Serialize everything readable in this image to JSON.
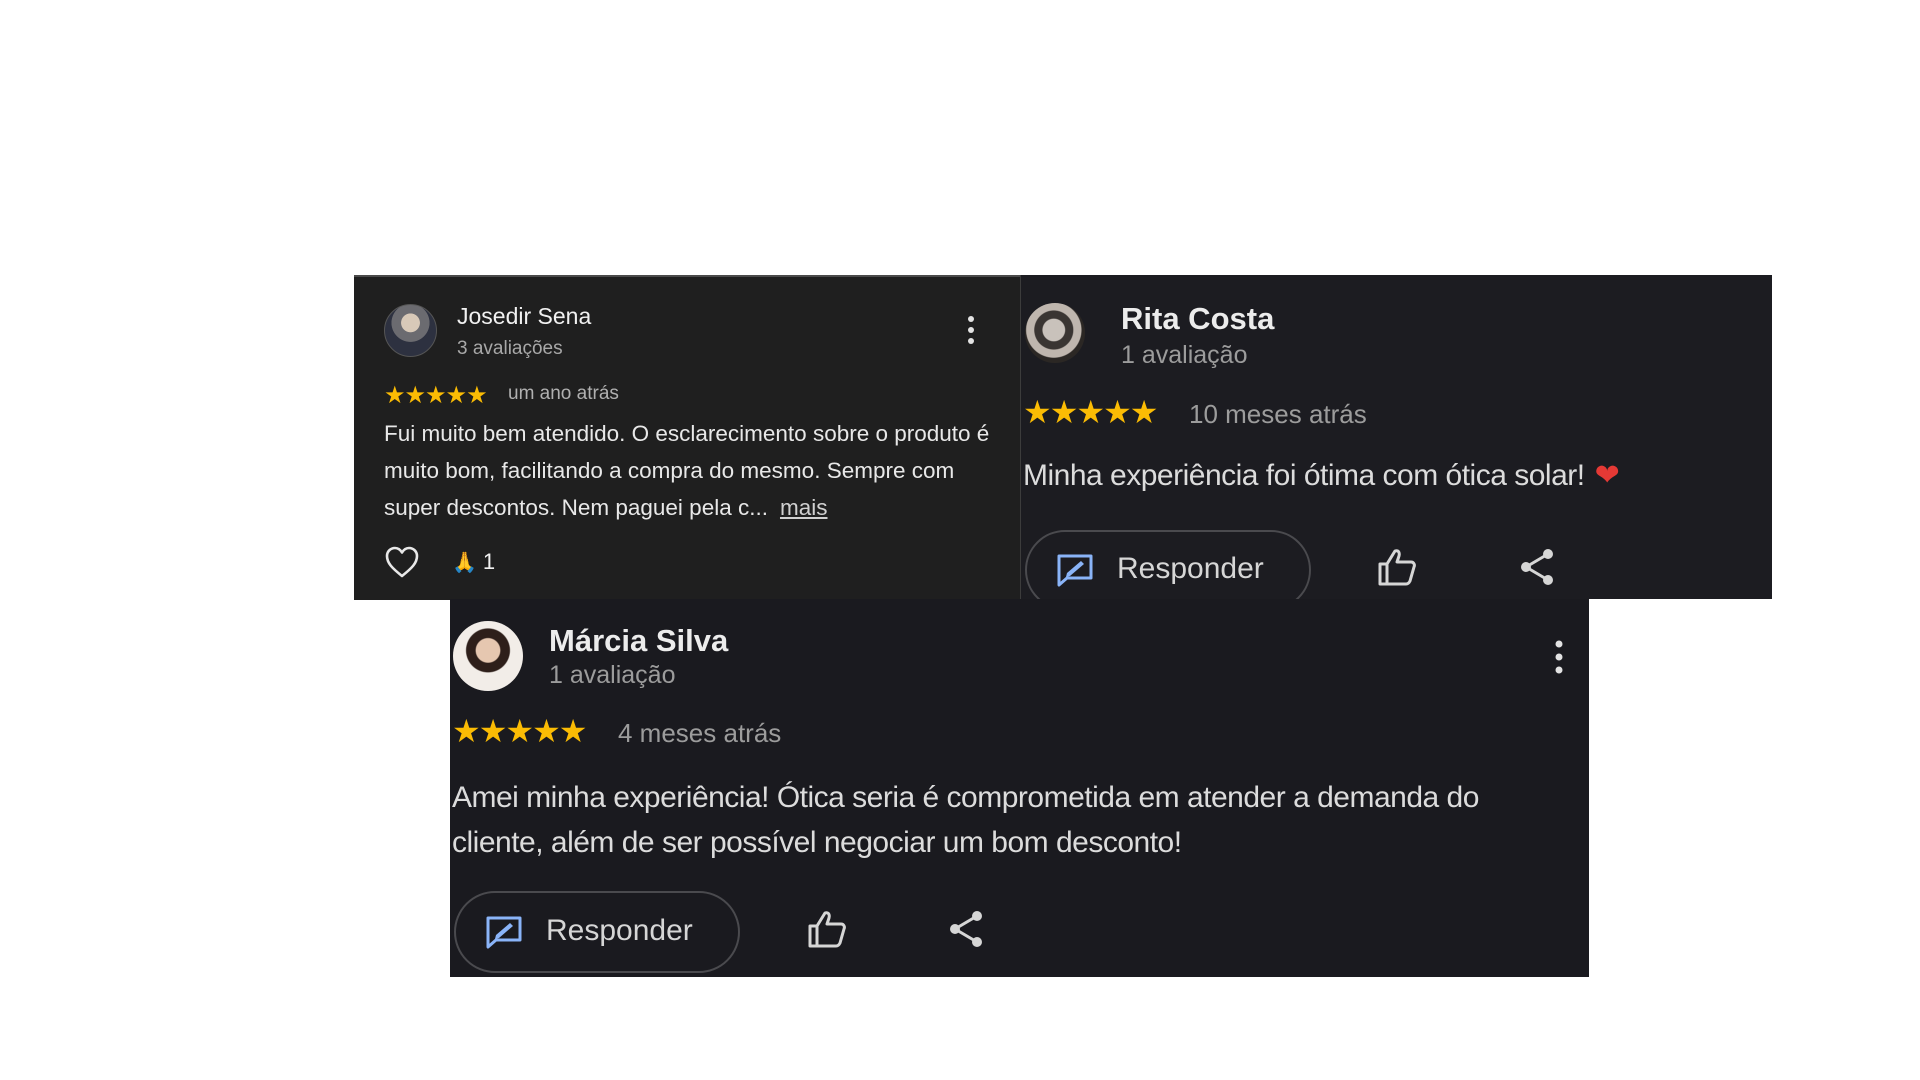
{
  "reviews": [
    {
      "name": "Josedir Sena",
      "subtitle": "3 avaliações",
      "stars": "★★★★★",
      "rating": 5,
      "time": "um ano atrás",
      "body": "Fui muito bem atendido. O esclarecimento sobre o produto é muito bom, facilitando a compra do mesmo. Sempre com super descontos. Nem paguei pela c...",
      "more": "mais",
      "reaction_emoji": "🙏",
      "reaction_count": "1"
    },
    {
      "name": "Rita Costa",
      "subtitle": "1 avaliação",
      "stars": "★★★★★",
      "rating": 5,
      "time": "10 meses atrás",
      "body": "Minha experiência foi ótima com ótica solar!",
      "emoji": "❤",
      "reply_label": "Responder"
    },
    {
      "name": "Márcia Silva",
      "subtitle": "1 avaliação",
      "stars": "★★★★★",
      "rating": 5,
      "time": "4 meses atrás",
      "body": "Amei minha experiência! Ótica seria é comprometida em atender a demanda do cliente, além de ser possível negociar um bom desconto!",
      "reply_label": "Responder"
    }
  ],
  "colors": {
    "star": "#fbbc04",
    "card_bg": "#1c1c1e",
    "reply_icon": "#8ab4f8"
  },
  "icons": {
    "menu": "kebab-menu-icon",
    "heart": "heart-icon",
    "reply": "reply-icon",
    "like": "thumbs-up-icon",
    "share": "share-icon"
  }
}
